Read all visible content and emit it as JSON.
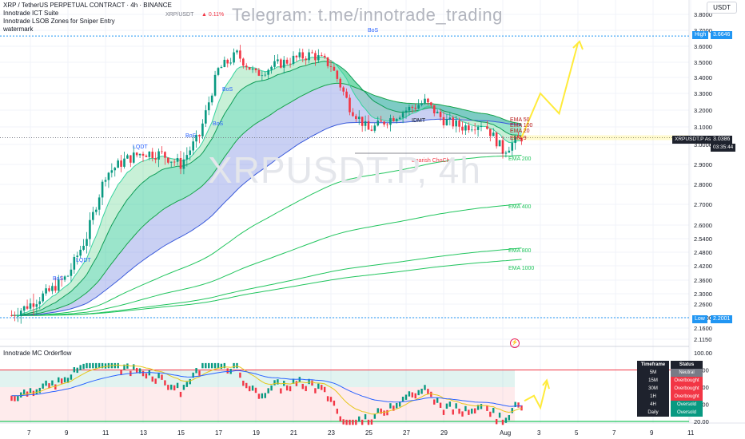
{
  "header": {
    "symbol_line": "XRP / TetherUS PERPETUAL CONTRACT · 4h · BINANCE",
    "indicator1": "Innotrade ICT Suite",
    "indicator2": "Innotrade LSOB Zones for Sniper Entry",
    "indicator3": "watermark",
    "compare_symbol": "XRP/USDT",
    "compare_change": "▲ 0.11%",
    "telegram": "Telegram: t.me/innotrade_trading",
    "bg_watermark": "XRPUSDT.P, 4h",
    "currency": "USDT"
  },
  "price_axis": {
    "ticks": [
      "3.8000",
      "3.7000",
      "3.6000",
      "3.5000",
      "3.4000",
      "3.3000",
      "3.2000",
      "3.1000",
      "3.0000",
      "2.9000",
      "2.8000",
      "2.7000",
      "2.6000",
      "2.5400",
      "2.4800",
      "2.4200",
      "2.3600",
      "2.3000",
      "2.2600",
      "2.2000",
      "2.1600",
      "2.1150"
    ],
    "high_label": "High",
    "high_value": "3.6646",
    "low_label": "Low",
    "low_value": "2.2001",
    "ask_label": "XRPUSDT.P Ask",
    "ask_value": "3.0386",
    "countdown": "03:35:44"
  },
  "time_axis": [
    "7",
    "9",
    "11",
    "13",
    "15",
    "17",
    "19",
    "21",
    "23",
    "25",
    "27",
    "29",
    "Aug",
    "3",
    "5",
    "7",
    "9",
    "11"
  ],
  "annotations": {
    "bos": "BoS",
    "lqdt": "LQDT",
    "idmt": "IDMT",
    "choch": "Bearish ChoCh",
    "ema9": "EMA 9",
    "ema20": "EMA 20",
    "ema50": "EMA 50",
    "ema100": "EMA 100",
    "ema200": "EMA 200",
    "ema400": "EMA 400",
    "ema800": "EMA 800",
    "ema1000": "EMA 1000"
  },
  "oscillator": {
    "title": "Innotrade MC Orderflow",
    "ticks": [
      "100.00",
      "80.00",
      "60.00",
      "40.00",
      "20.00"
    ],
    "table_header": [
      "Timeframe",
      "Status"
    ],
    "table_rows": [
      {
        "tf": "5M",
        "status": "Neutral",
        "color": "#787b86"
      },
      {
        "tf": "15M",
        "status": "Overbought",
        "color": "#f23645"
      },
      {
        "tf": "30M",
        "status": "Overbought",
        "color": "#f23645"
      },
      {
        "tf": "1H",
        "status": "Overbought",
        "color": "#f23645"
      },
      {
        "tf": "4H",
        "status": "Oversold",
        "color": "#089981"
      },
      {
        "tf": "Daily",
        "status": "Oversold",
        "color": "#089981"
      }
    ]
  },
  "colors": {
    "up": "#089981",
    "down": "#f23645",
    "ema_green": "#22c55e",
    "projection": "#ffeb3b",
    "level": "#2196f3"
  },
  "chart_data": {
    "type": "candlestick",
    "title": "XRP / TetherUS PERPETUAL CONTRACT · 4h · BINANCE",
    "x_labels": [
      "7",
      "9",
      "11",
      "13",
      "15",
      "17",
      "19",
      "21",
      "23",
      "25",
      "27",
      "29",
      "Aug",
      "3",
      "5",
      "7",
      "9",
      "11"
    ],
    "ylim": [
      2.115,
      3.8
    ],
    "close_path": [
      [
        "Jul 6",
        2.21
      ],
      [
        "Jul 7",
        2.26
      ],
      [
        "Jul 8",
        2.31
      ],
      [
        "Jul 9",
        2.38
      ],
      [
        "Jul 10",
        2.55
      ],
      [
        "Jul 11",
        2.85
      ],
      [
        "Jul 12",
        2.92
      ],
      [
        "Jul 13",
        2.96
      ],
      [
        "Jul 14",
        2.95
      ],
      [
        "Jul 15",
        2.9
      ],
      [
        "Jul 16",
        3.05
      ],
      [
        "Jul 17",
        3.45
      ],
      [
        "Jul 18",
        3.55
      ],
      [
        "Jul 19",
        3.42
      ],
      [
        "Jul 20",
        3.48
      ],
      [
        "Jul 21",
        3.52
      ],
      [
        "Jul 22",
        3.55
      ],
      [
        "Jul 23",
        3.48
      ],
      [
        "Jul 24",
        3.22
      ],
      [
        "Jul 25",
        3.08
      ],
      [
        "Jul 26",
        3.14
      ],
      [
        "Jul 27",
        3.2
      ],
      [
        "Jul 28",
        3.25
      ],
      [
        "Jul 29",
        3.14
      ],
      [
        "Jul 30",
        3.1
      ],
      [
        "Jul 31",
        3.12
      ],
      [
        "Aug 1",
        2.97
      ],
      [
        "Aug 2",
        3.04
      ]
    ],
    "high": 3.6646,
    "low": 2.2001,
    "last": 3.0386,
    "projection": [
      [
        "Aug 2",
        3.04
      ],
      [
        "Aug 3",
        3.3
      ],
      [
        "Aug 4",
        3.18
      ],
      [
        "Aug 5",
        3.62
      ]
    ],
    "emas": [
      "EMA 9",
      "EMA 20",
      "EMA 50",
      "EMA 100",
      "EMA 200",
      "EMA 400",
      "EMA 800",
      "EMA 1000"
    ],
    "ema_end_values": {
      "EMA 9": 3.05,
      "EMA 20": 3.08,
      "EMA 100": 3.12,
      "EMA 50": 3.15,
      "EMA 200": 2.92,
      "EMA 400": 2.69,
      "EMA 800": 2.47,
      "EMA 1000": 2.41
    },
    "oscillator_ylim": [
      20,
      100
    ],
    "oscillator_last": 40
  }
}
